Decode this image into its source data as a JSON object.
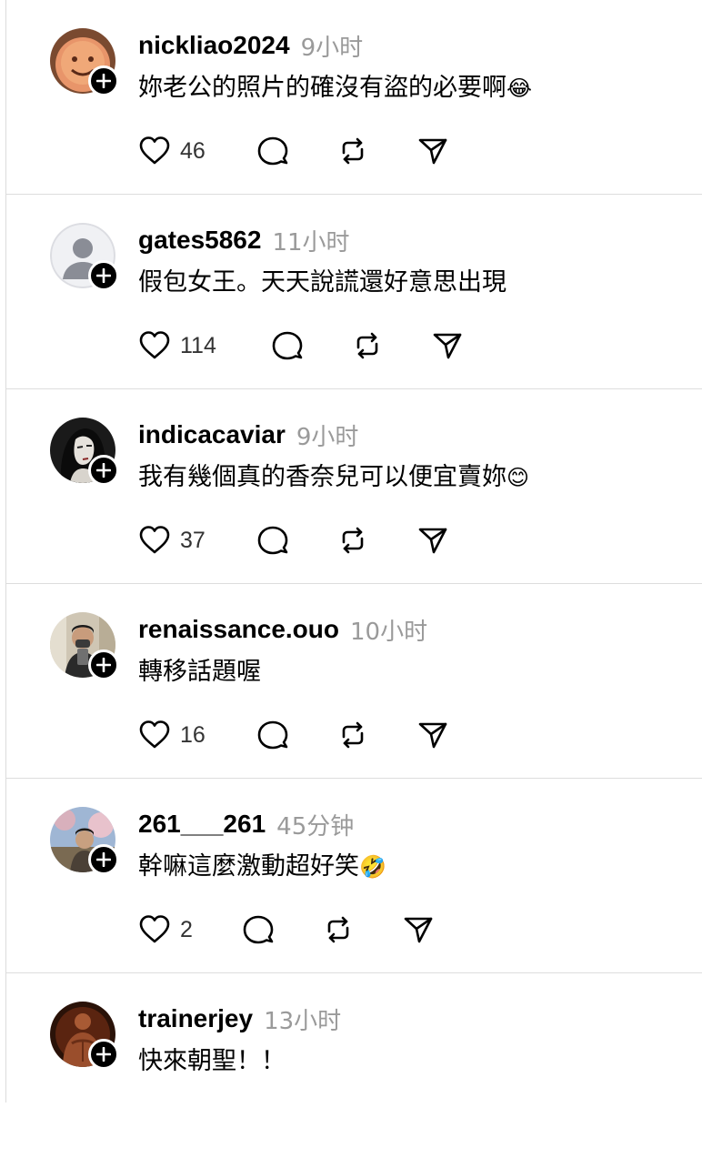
{
  "accent_colors": {
    "text": "#000000",
    "timestamp": "#9a9a9a",
    "divider": "#dddddd",
    "badge": "#000000"
  },
  "posts": [
    {
      "username": "nickliao2024",
      "time": "9小时",
      "text": "妳老公的照片的確沒有盜的必要啊",
      "emoji": "😂",
      "likes": "46",
      "avatar_icon": "smiley-avatar-icon"
    },
    {
      "username": "gates5862",
      "time": "11小时",
      "text": "假包女王。天天說謊還好意思出現",
      "emoji": "",
      "likes": "114",
      "avatar_icon": "default-user-avatar-icon"
    },
    {
      "username": "indicacaviar",
      "time": "9小时",
      "text": "我有幾個真的香奈兒可以便宜賣妳",
      "emoji": "😊",
      "likes": "37",
      "avatar_icon": "illustrated-portrait-avatar-icon"
    },
    {
      "username": "renaissance.ouo",
      "time": "10小时",
      "text": "轉移話題喔",
      "emoji": "",
      "likes": "16",
      "avatar_icon": "mirror-selfie-avatar-icon"
    },
    {
      "username": "261___261",
      "time": "45分钟",
      "text": "幹嘛這麼激動超好笑",
      "emoji": "🤣",
      "likes": "2",
      "avatar_icon": "outdoor-photo-avatar-icon"
    },
    {
      "username": "trainerjey",
      "time": "13小时",
      "text": "快來朝聖！！",
      "emoji": "",
      "likes": "",
      "avatar_icon": "fitness-photo-avatar-icon"
    }
  ]
}
